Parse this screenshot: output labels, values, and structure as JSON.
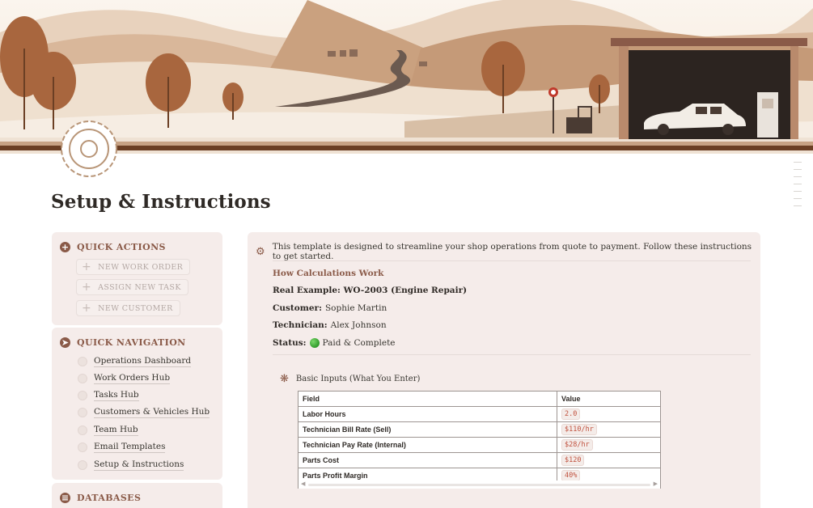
{
  "page": {
    "title": "Setup & Instructions"
  },
  "quick_actions": {
    "heading": "QUICK ACTIONS",
    "heading_icon": "plus-circle-icon",
    "buttons": [
      {
        "label": "NEW WORK ORDER",
        "icon": "plus-icon"
      },
      {
        "label": "ASSIGN NEW TASK",
        "icon": "plus-icon"
      },
      {
        "label": "NEW CUSTOMER",
        "icon": "plus-icon"
      }
    ]
  },
  "quick_navigation": {
    "heading": "QUICK NAVIGATION",
    "heading_icon": "compass-icon",
    "items": [
      {
        "label": "Operations Dashboard"
      },
      {
        "label": "Work Orders Hub"
      },
      {
        "label": "Tasks Hub"
      },
      {
        "label": "Customers & Vehicles Hub"
      },
      {
        "label": "Team Hub"
      },
      {
        "label": "Email Templates"
      },
      {
        "label": "Setup & Instructions"
      }
    ]
  },
  "databases": {
    "heading": "DATABASES",
    "heading_icon": "database-icon"
  },
  "instructions": {
    "intro_icon": "gear-icon",
    "intro": "This template is designed to streamline your shop operations from quote to payment. Follow these instructions to get started.",
    "calc_heading": "How Calculations Work",
    "example_title": "Real Example: WO-2003 (Engine Repair)",
    "customer_label": "Customer:",
    "customer_value": "Sophie Martin",
    "technician_label": "Technician:",
    "technician_value": "Alex Johnson",
    "status_label": "Status:",
    "status_value": "Paid & Complete",
    "status_color": "#2f9a2a",
    "basic_inputs_icon": "asterisk-icon",
    "basic_inputs_heading": "Basic Inputs (What You Enter)",
    "table": {
      "headers": [
        "Field",
        "Value"
      ],
      "rows": [
        [
          "Labor Hours",
          "2.0"
        ],
        [
          "Technician Bill Rate (Sell)",
          "$110/hr"
        ],
        [
          "Technician Pay Rate (Internal)",
          "$28/hr"
        ],
        [
          "Parts Cost",
          "$120"
        ],
        [
          "Parts Profit Margin",
          "40%"
        ]
      ]
    }
  },
  "colors": {
    "accent": "#8a5a48",
    "card_bg": "#f5ecea",
    "code_text": "#c1523f"
  }
}
